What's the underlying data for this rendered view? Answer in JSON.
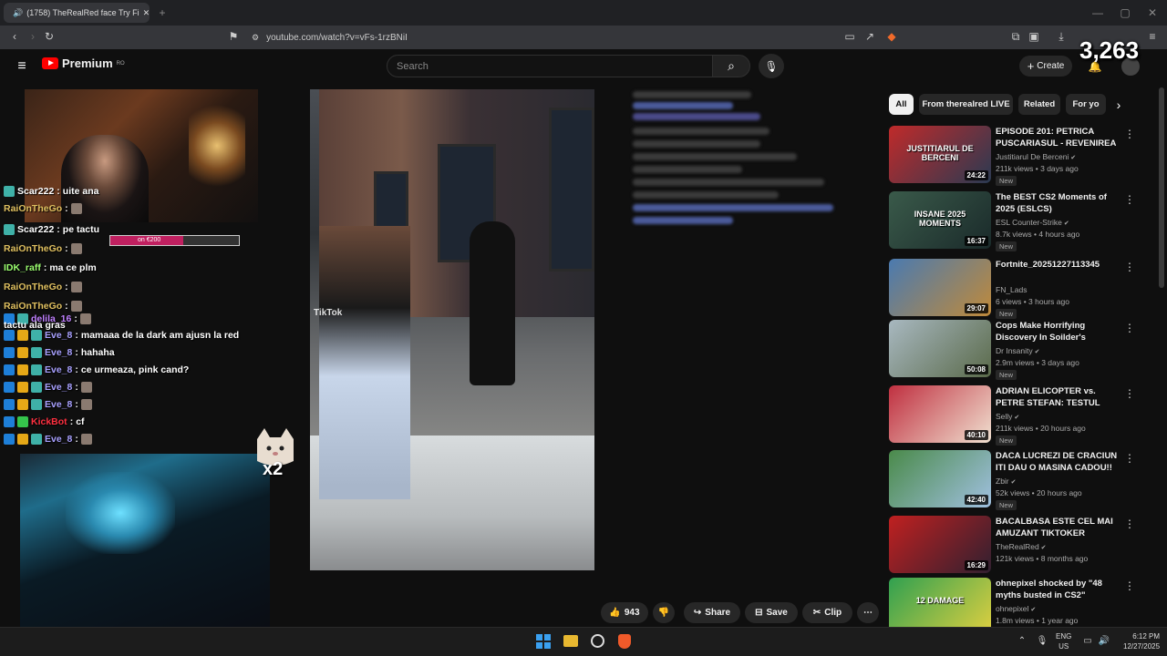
{
  "browser": {
    "tab_title": "(1758) TheRealRed face Try Fi",
    "url": "youtube.com/watch?v=vFs-1rzBNiI"
  },
  "header": {
    "logo_text": "Premium",
    "logo_region": "RO",
    "search_placeholder": "Search",
    "create_label": "Create"
  },
  "stream": {
    "viewer_count": "3,263",
    "donation_label": "on €200",
    "cat_multiplier": "x2",
    "tiktok_watermark": "TikTok"
  },
  "chat": [
    {
      "user": "Scar222",
      "msg": "uite ana",
      "color": "#ffffff",
      "badges": [
        "bg"
      ]
    },
    {
      "user": "RaiOnTheGo",
      "msg": "",
      "color": "#e0c060",
      "badges": []
    },
    {
      "user": "Scar222",
      "msg": "pe tactu",
      "color": "#ffffff",
      "badges": [
        "bg"
      ]
    },
    {
      "user": "RaiOnTheGo",
      "msg": "",
      "color": "#e0c060",
      "badges": []
    },
    {
      "user": "IDK_raff",
      "msg": "ma ce plm",
      "color": "#9cff70",
      "badges": []
    },
    {
      "user": "RaiOnTheGo",
      "msg": "",
      "color": "#e0c060",
      "badges": []
    },
    {
      "user": "RaiOnTheGo",
      "msg": "",
      "color": "#e0c060",
      "badges": []
    },
    {
      "user": "delila_16",
      "msg": "",
      "color": "#c080ff",
      "badges": [
        "bt",
        "bg"
      ]
    },
    {
      "user": "",
      "msg": "tactu ala gras",
      "color": "#ffffff",
      "badges": []
    },
    {
      "user": "Eve_8",
      "msg": "mamaaa de la dark am ajusn la red",
      "color": "#a8a0ff",
      "badges": [
        "bt",
        "by",
        "bg"
      ]
    },
    {
      "user": "Eve_8",
      "msg": "hahaha",
      "color": "#a8a0ff",
      "badges": [
        "bt",
        "by",
        "bg"
      ]
    },
    {
      "user": "Eve_8",
      "msg": "ce urmeaza, pink cand?",
      "color": "#a8a0ff",
      "badges": [
        "bt",
        "by",
        "bg"
      ]
    },
    {
      "user": "Eve_8",
      "msg": "",
      "color": "#a8a0ff",
      "badges": [
        "bt",
        "by",
        "bg"
      ]
    },
    {
      "user": "Eve_8",
      "msg": "",
      "color": "#a8a0ff",
      "badges": [
        "bt",
        "by",
        "bg"
      ]
    },
    {
      "user": "KickBot",
      "msg": "cf",
      "color": "#ff3040",
      "badges": [
        "bt",
        "bg2"
      ]
    },
    {
      "user": "Eve_8",
      "msg": "",
      "color": "#a8a0ff",
      "badges": [
        "bt",
        "by",
        "bg"
      ]
    }
  ],
  "actions": {
    "likes": "943",
    "share": "Share",
    "save": "Save",
    "clip": "Clip"
  },
  "chips": [
    "All",
    "From therealred LIVE",
    "Related",
    "For yo"
  ],
  "recs": [
    {
      "title": "EPISODE 201: PETRICA PUSCARIASUL - REVENIREA ...",
      "channel": "Justitiarul De Berceni",
      "meta": "211k views • 3 days ago",
      "new": "New",
      "duration": "24:22",
      "thumb": [
        "#c02a2a",
        "#2a3a52"
      ],
      "verified": true,
      "thumb_text": "JUSTITIARUL DE BERCENI"
    },
    {
      "title": "The BEST CS2 Moments of 2025 (ESLCS)",
      "channel": "ESL Counter-Strike",
      "meta": "8.7k views • 4 hours ago",
      "new": "New",
      "duration": "16:37",
      "thumb": [
        "#3a5a4a",
        "#1a2a2a"
      ],
      "verified": true,
      "thumb_text": "INSANE 2025 MOMENTS"
    },
    {
      "title": "Fortnite_20251227113345",
      "channel": "FN_Lads",
      "meta": "6 views • 3 hours ago",
      "new": "New",
      "duration": "29:07",
      "thumb": [
        "#4a7ab0",
        "#c08a3a"
      ],
      "verified": false,
      "thumb_text": ""
    },
    {
      "title": "Cops Make Horrifying Discovery In Soilder's Bedroom",
      "channel": "Dr Insanity",
      "meta": "2.9m views • 3 days ago",
      "new": "New",
      "duration": "50:08",
      "thumb": [
        "#a8b8c0",
        "#5a6a4a"
      ],
      "verified": true,
      "thumb_text": ""
    },
    {
      "title": "ADRIAN ELICOPTER vs. PETRE STEFAN: TESTUL POLIGRAF ...",
      "channel": "Selly",
      "meta": "211k views • 20 hours ago",
      "new": "New",
      "duration": "40:10",
      "thumb": [
        "#c03040",
        "#f0e0d0"
      ],
      "verified": true,
      "thumb_text": ""
    },
    {
      "title": "DACA LUCREZI DE CRACIUN ITI DAU O MASINA CADOU!!",
      "channel": "Zbir",
      "meta": "52k views • 20 hours ago",
      "new": "New",
      "duration": "42:40",
      "thumb": [
        "#4a8a4a",
        "#a0c0e0"
      ],
      "verified": true,
      "thumb_text": ""
    },
    {
      "title": "BACALBASA ESTE CEL MAI AMUZANT TIKTOKER",
      "channel": "TheRealRed",
      "meta": "121k views • 8 months ago",
      "new": "",
      "duration": "16:29",
      "thumb": [
        "#c02020",
        "#302030"
      ],
      "verified": true,
      "thumb_text": ""
    },
    {
      "title": "ohnepixel shocked by \"48 myths busted in CS2\"",
      "channel": "ohnepixel",
      "meta": "1.8m views • 1 year ago",
      "new": "",
      "duration": "",
      "thumb": [
        "#30a050",
        "#e0d040"
      ],
      "verified": true,
      "thumb_text": "12 DAMAGE"
    }
  ],
  "taskbar": {
    "lang_1": "ENG",
    "lang_2": "US",
    "time": "6:12 PM",
    "date": "12/27/2025"
  },
  "colors": {
    "yt_red": "#ff0000",
    "bg": "#0f0f0f",
    "chip": "#272727"
  }
}
